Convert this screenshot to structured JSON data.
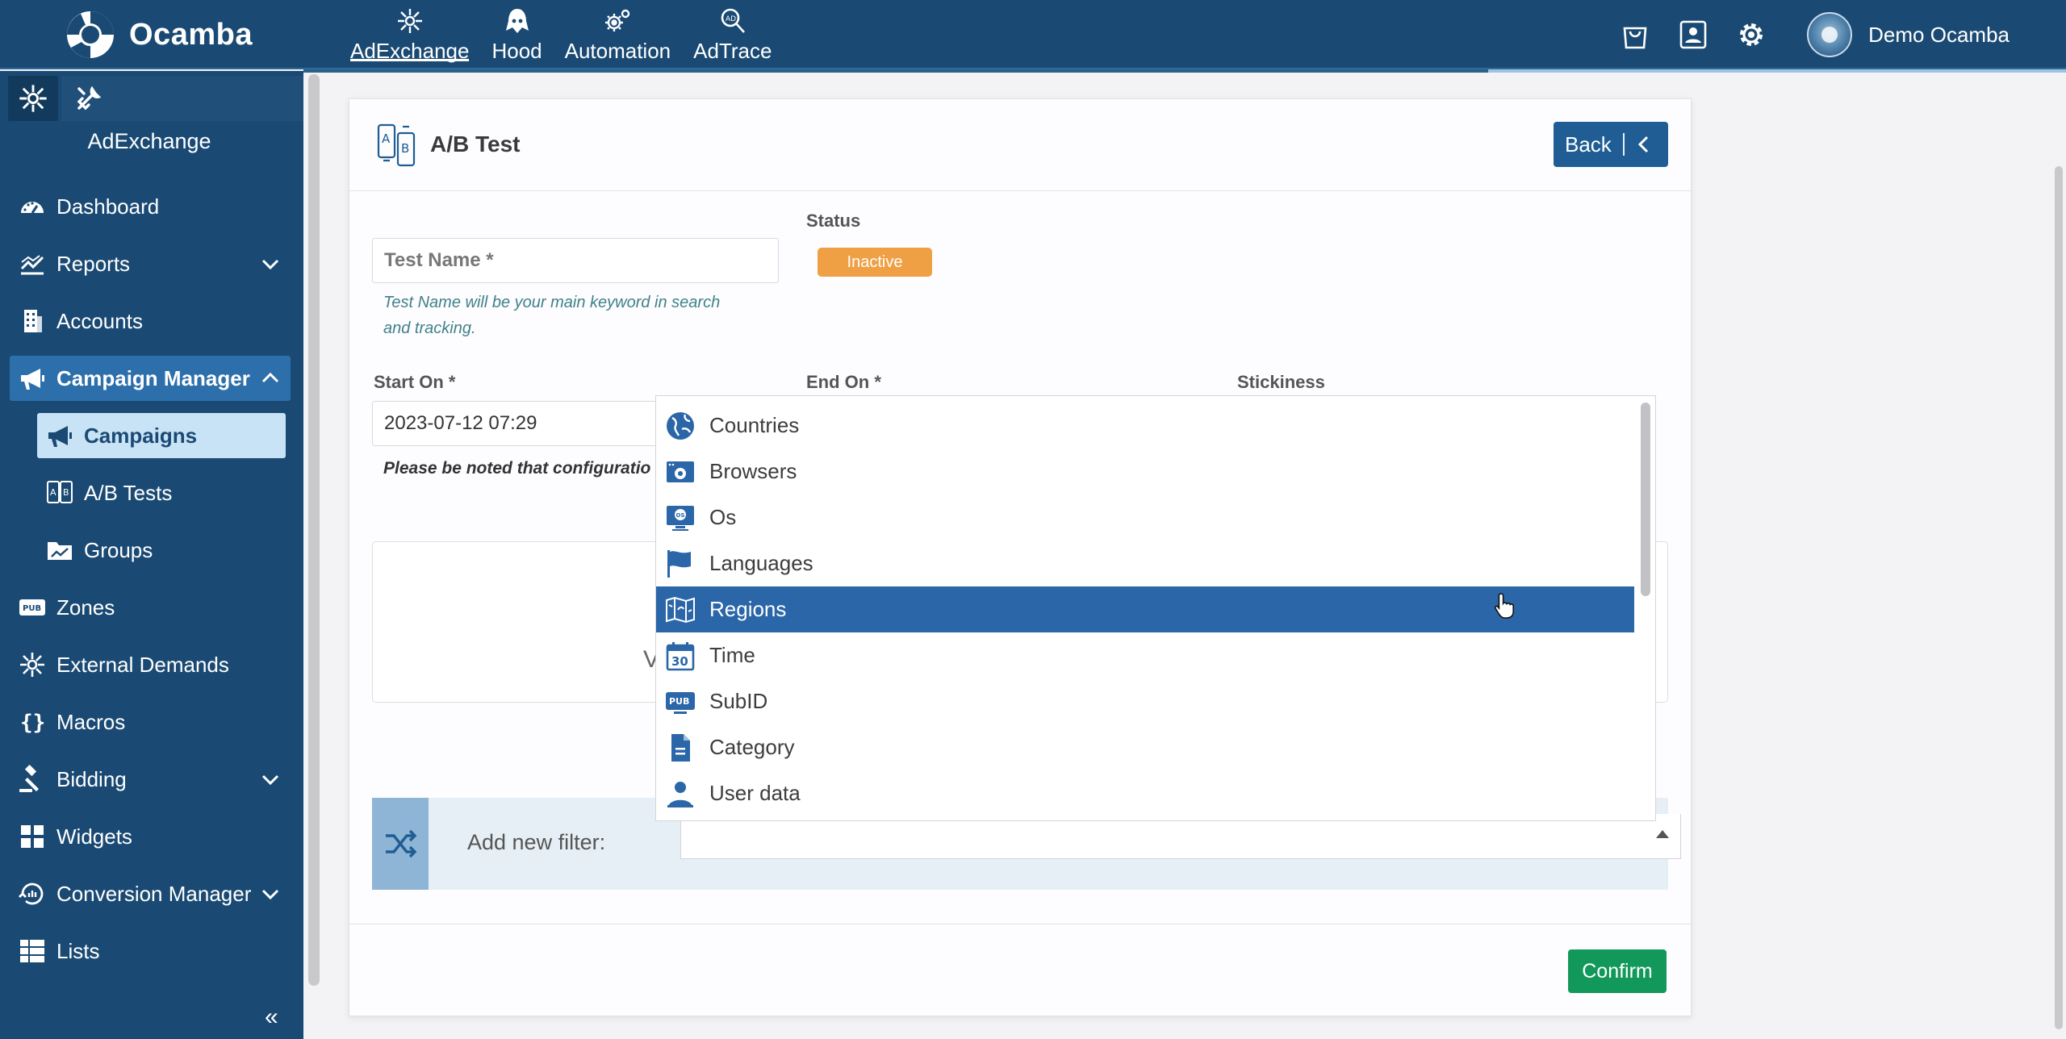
{
  "brand": {
    "name": "Ocamba"
  },
  "topnav": [
    {
      "label": "AdExchange",
      "icon": "adexchange-icon",
      "active": true
    },
    {
      "label": "Hood",
      "icon": "hood-icon",
      "active": false
    },
    {
      "label": "Automation",
      "icon": "automation-icon",
      "active": false
    },
    {
      "label": "AdTrace",
      "icon": "adtrace-icon",
      "active": false
    }
  ],
  "user": {
    "name": "Demo Ocamba"
  },
  "sidebar": {
    "title": "AdExchange",
    "items": [
      {
        "label": "Dashboard",
        "icon": "dashboard-icon"
      },
      {
        "label": "Reports",
        "icon": "reports-icon",
        "expandable": true
      },
      {
        "label": "Accounts",
        "icon": "accounts-icon"
      },
      {
        "label": "Campaign Manager",
        "icon": "megaphone-icon",
        "expandable": true,
        "expanded": true
      },
      {
        "label": "Campaigns",
        "icon": "megaphone-icon",
        "sub": true,
        "active": true
      },
      {
        "label": "A/B Tests",
        "icon": "ab-test-icon",
        "sub": true
      },
      {
        "label": "Groups",
        "icon": "folder-chart-icon",
        "sub": true
      },
      {
        "label": "Zones",
        "icon": "pub-icon"
      },
      {
        "label": "External Demands",
        "icon": "network-icon"
      },
      {
        "label": "Macros",
        "icon": "braces-icon"
      },
      {
        "label": "Bidding",
        "icon": "gavel-icon",
        "expandable": true
      },
      {
        "label": "Widgets",
        "icon": "widgets-icon"
      },
      {
        "label": "Conversion Manager",
        "icon": "conversion-icon",
        "expandable": true
      },
      {
        "label": "Lists",
        "icon": "lists-icon"
      }
    ],
    "collapse_glyph": "«"
  },
  "card": {
    "title": "A/B Test",
    "back_label": "Back",
    "test_name_placeholder": "Test Name *",
    "test_name_hint_1": "Test Name will be your main keyword in search",
    "test_name_hint_2": "and tracking.",
    "status_label": "Status",
    "status_value": "Inactive",
    "start_label": "Start On *",
    "start_value": "2023-07-12 07:29",
    "end_label": "End On *",
    "stickiness_label": "Stickiness",
    "note": "Please be noted that configuratio",
    "ghost_letter": "V",
    "filter_label": "Add new filter:",
    "confirm_label": "Confirm"
  },
  "dropdown": {
    "options": [
      {
        "label": "Countries",
        "icon": "globe-icon"
      },
      {
        "label": "Browsers",
        "icon": "browser-icon"
      },
      {
        "label": "Os",
        "icon": "os-monitor-icon"
      },
      {
        "label": "Languages",
        "icon": "flag-icon"
      },
      {
        "label": "Regions",
        "icon": "map-icon",
        "highlighted": true
      },
      {
        "label": "Time",
        "icon": "calendar-icon"
      },
      {
        "label": "SubID",
        "icon": "pub-icon"
      },
      {
        "label": "Category",
        "icon": "document-icon"
      },
      {
        "label": "User data",
        "icon": "user-icon"
      }
    ]
  },
  "colors": {
    "brand": "#1a4a73",
    "accent": "#2a66a8",
    "status_inactive": "#f0a044",
    "confirm": "#12985a"
  }
}
